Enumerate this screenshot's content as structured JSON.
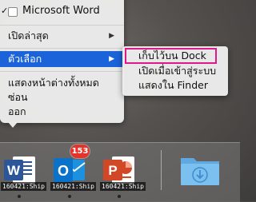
{
  "menu": {
    "app_title": "Microsoft Word",
    "items": [
      {
        "label": "เปิดล่าสุด",
        "arrow": "▶"
      },
      {
        "label": "ตัวเลือก",
        "arrow": "▶"
      },
      {
        "label": "แสดงหน้าต่างทั้งหมด"
      },
      {
        "label": "ซ่อน"
      },
      {
        "label": "ออก"
      }
    ],
    "checkmark": "✓"
  },
  "submenu": {
    "items": [
      {
        "label": "เก็บไว้บน Dock"
      },
      {
        "label": "เปิดเมื่อเข้าสู่ระบบ"
      },
      {
        "label": "แสดงใน Finder"
      }
    ]
  },
  "dock": {
    "apps": [
      {
        "name": "Word",
        "letter": "W",
        "caption": "160421:Ship",
        "color": "#2b579a"
      },
      {
        "name": "Outlook",
        "letter": "O",
        "caption": "160421:Ship",
        "color": "#0a72c9"
      },
      {
        "name": "PowerPoint",
        "letter": "P",
        "caption": "160421:Ship",
        "color": "#d24726"
      },
      {
        "name": "Downloads",
        "icon": "downloads-folder-icon",
        "color": "#6fb3e8"
      }
    ],
    "outlook_badge": "153"
  },
  "colors": {
    "highlight": "#1a63d8",
    "callout": "#e0198a"
  }
}
